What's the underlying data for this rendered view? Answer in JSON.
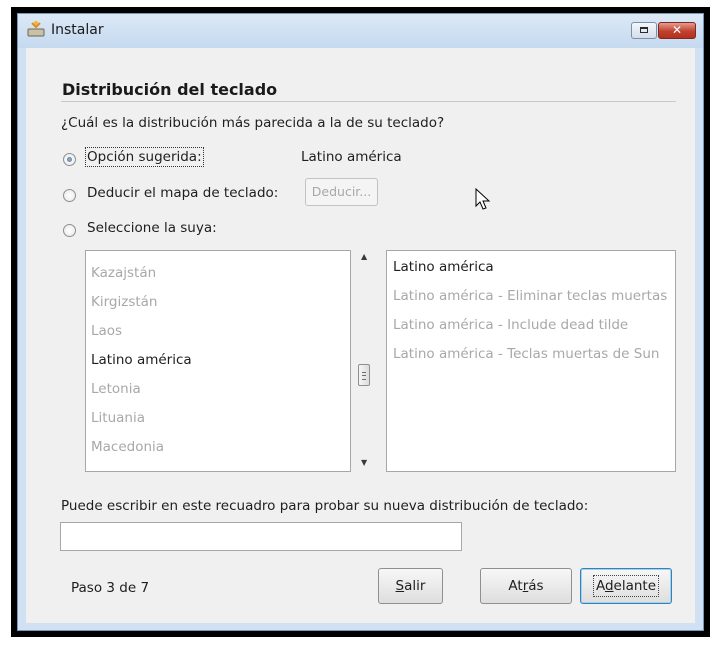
{
  "window": {
    "title": "Instalar",
    "close_glyph": "✕"
  },
  "section": {
    "heading": "Distribución del teclado",
    "question": "¿Cuál es la distribución más parecida a la de su teclado?"
  },
  "options": {
    "suggested_label": "Opción sugerida:",
    "suggested_value": "Latino américa",
    "deduce_label": "Deducir el mapa de teclado:",
    "deduce_button": "Deducir...",
    "choose_label": "Seleccione la suya:"
  },
  "layouts": {
    "items": [
      "Kazajstán",
      "Kirgizstán",
      "Laos",
      "Latino américa",
      "Letonia",
      "Lituania",
      "Macedonia"
    ],
    "selected": "Latino américa"
  },
  "variants": {
    "items": [
      "Latino américa",
      "Latino américa - Eliminar teclas muertas",
      "Latino américa - Include dead tilde",
      "Latino américa - Teclas muertas de Sun"
    ],
    "selected": "Latino américa"
  },
  "test": {
    "hint": "Puede escribir en este recuadro para probar su nueva distribución de teclado:",
    "value": ""
  },
  "footer": {
    "step": "Paso 3 de 7",
    "quit_pre": "",
    "quit_key": "S",
    "quit_post": "alir",
    "back_pre": "At",
    "back_key": "r",
    "back_post": "ás",
    "next_pre": "A",
    "next_key": "d",
    "next_post": "elante"
  },
  "icons": {
    "app": "installer-icon",
    "minimize": "minimize-icon",
    "close": "close-icon",
    "scroll_up": "chevron-up-icon",
    "scroll_down": "chevron-down-icon",
    "cursor": "mouse-pointer-icon"
  }
}
